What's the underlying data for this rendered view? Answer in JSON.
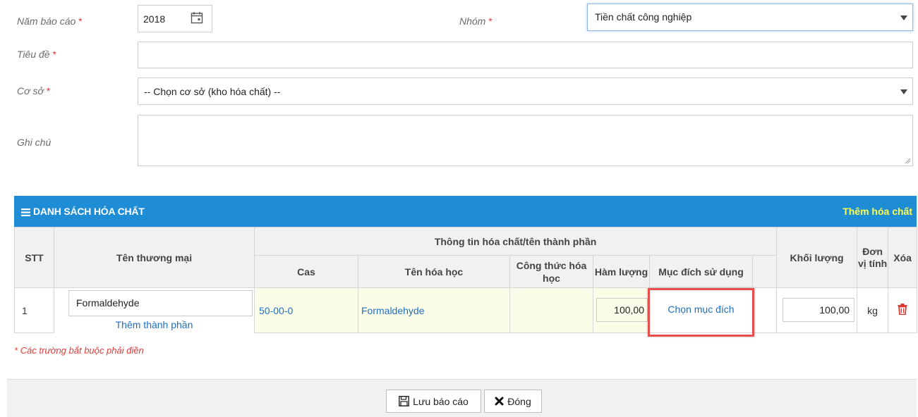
{
  "form": {
    "year_label": "Năm báo cáo",
    "year_value": "2018",
    "group_label": "Nhóm",
    "group_value": "Tiền chất công nghiệp",
    "title_label": "Tiêu đề",
    "title_value": "",
    "facility_label": "Cơ sở",
    "facility_value": "-- Chọn cơ sở (kho hóa chất) --",
    "note_label": "Ghi chú",
    "note_value": "",
    "required_mark": "*"
  },
  "list": {
    "title": "DANH SÁCH HÓA CHẤT",
    "add_link": "Thêm hóa chất",
    "headers": {
      "stt": "STT",
      "trade_name": "Tên thương mại",
      "info_group": "Thông tin hóa chất/tên thành phần",
      "cas": "Cas",
      "chem_name": "Tên hóa học",
      "formula": "Công thức hóa học",
      "content": "Hàm lượng",
      "purpose": "Mục đích sử dụng",
      "weight": "Khối lượng",
      "unit": "Đơn vị tính",
      "delete": "Xóa"
    },
    "rows": [
      {
        "stt": "1",
        "trade_name": "Formaldehyde",
        "add_component": "Thêm thành phần",
        "cas": "50-00-0",
        "chem_name": "Formaldehyde",
        "formula": "",
        "content": "100,00",
        "purpose": "Chọn mục đích",
        "weight": "100,00",
        "unit": "kg"
      }
    ]
  },
  "required_note": "* Các trường bắt buộc phải điền",
  "buttons": {
    "save": "Lưu báo cáo",
    "close": "Đóng"
  },
  "colors": {
    "header_blue": "#1f8dd6",
    "add_link": "#ffff4d",
    "link_blue": "#1f6fbf",
    "required_red": "#e03a3a",
    "highlight_red": "#e84c4c"
  },
  "icons": [
    "calendar-icon",
    "list-icon",
    "trash-icon",
    "save-icon",
    "close-icon",
    "dropdown-caret-icon"
  ]
}
